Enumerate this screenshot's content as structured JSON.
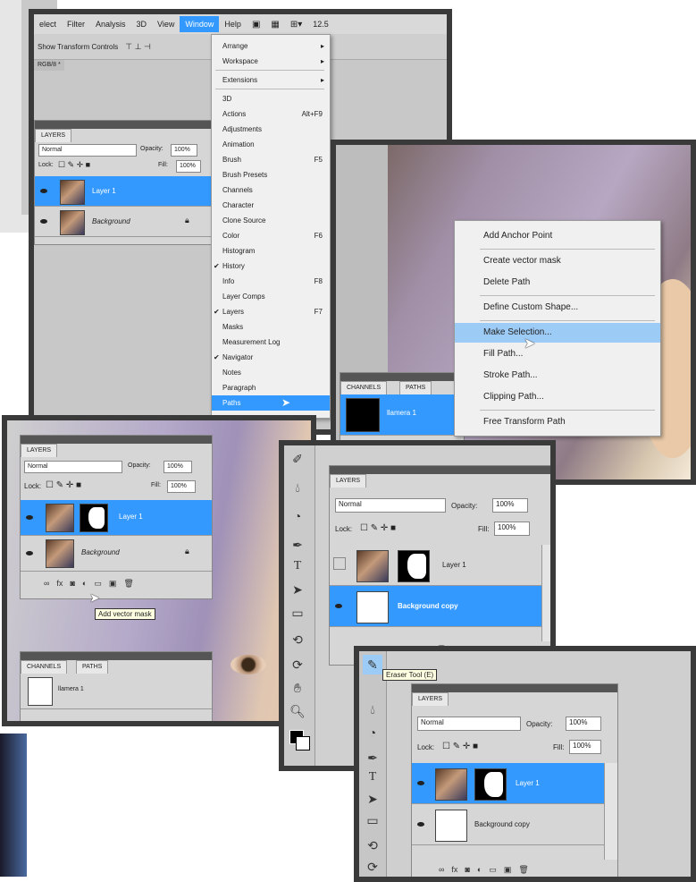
{
  "menubar": {
    "items": [
      "elect",
      "Filter",
      "Analysis",
      "3D",
      "View",
      "Window",
      "Help"
    ],
    "zoom": "12.5"
  },
  "options_bar": {
    "label": "Show Transform Controls"
  },
  "doc_tab": "RGB/8 *",
  "window_menu": {
    "items": [
      {
        "label": "Arrange",
        "arrow": true
      },
      {
        "label": "Workspace",
        "arrow": true
      },
      {
        "label": "Extensions",
        "arrow": true
      },
      {
        "label": "3D"
      },
      {
        "label": "Actions",
        "key": "Alt+F9"
      },
      {
        "label": "Adjustments"
      },
      {
        "label": "Animation"
      },
      {
        "label": "Brush",
        "key": "F5"
      },
      {
        "label": "Brush Presets"
      },
      {
        "label": "Channels"
      },
      {
        "label": "Character"
      },
      {
        "label": "Clone Source"
      },
      {
        "label": "Color",
        "key": "F6"
      },
      {
        "label": "Histogram"
      },
      {
        "label": "History",
        "check": true
      },
      {
        "label": "Info",
        "key": "F8"
      },
      {
        "label": "Layer Comps"
      },
      {
        "label": "Layers",
        "key": "F7",
        "check": true
      },
      {
        "label": "Masks"
      },
      {
        "label": "Measurement Log"
      },
      {
        "label": "Navigator",
        "check": true
      },
      {
        "label": "Notes"
      },
      {
        "label": "Paragraph"
      },
      {
        "label": "Paths",
        "highlight": true
      }
    ]
  },
  "context_menu": {
    "items": [
      {
        "label": "Add Anchor Point"
      },
      {
        "label": "Create vector mask"
      },
      {
        "label": "Delete Path"
      },
      {
        "label": "Define Custom Shape..."
      },
      {
        "label": "Make Selection...",
        "highlight": true
      },
      {
        "label": "Fill Path..."
      },
      {
        "label": "Stroke Path..."
      },
      {
        "label": "Clipping Path..."
      },
      {
        "label": "Free Transform Path"
      }
    ]
  },
  "channels_paths": {
    "tab_channels": "CHANNELS",
    "tab_paths": "PATHS",
    "path_name": "llamera 1"
  },
  "layers1": {
    "tab": "LAYERS",
    "blend": "Normal",
    "opacity_label": "Opacity:",
    "opacity": "100%",
    "lock_label": "Lock:",
    "fill_label": "Fill:",
    "fill": "100%",
    "layer1": "Layer 1",
    "background": "Background"
  },
  "layers2": {
    "tab": "LAYERS",
    "blend": "Normal",
    "opacity_label": "Opacity:",
    "opacity": "100%",
    "lock_label": "Lock:",
    "fill_label": "Fill:",
    "fill": "100%",
    "layer1": "Layer 1",
    "background": "Background",
    "tooltip": "Add vector mask",
    "paths_tab_channels": "CHANNELS",
    "paths_tab_paths": "PATHS",
    "path_name": "llamera 1"
  },
  "layers3": {
    "tab": "LAYERS",
    "blend": "Normal",
    "opacity_label": "Opacity:",
    "opacity": "100%",
    "lock_label": "Lock:",
    "fill_label": "Fill:",
    "fill": "100%",
    "layer1": "Layer 1",
    "background_copy": "Background copy"
  },
  "layers4": {
    "tab": "LAYERS",
    "blend": "Normal",
    "opacity_label": "Opacity:",
    "opacity": "100%",
    "lock_label": "Lock:",
    "fill_label": "Fill:",
    "fill": "100%",
    "layer1": "Layer 1",
    "background_copy": "Background copy",
    "tooltip": "Eraser Tool (E)"
  },
  "colors": {
    "selection": "#3399ff",
    "menu_highlight": "#9ccbf5",
    "frame": "#3a3a3a"
  }
}
